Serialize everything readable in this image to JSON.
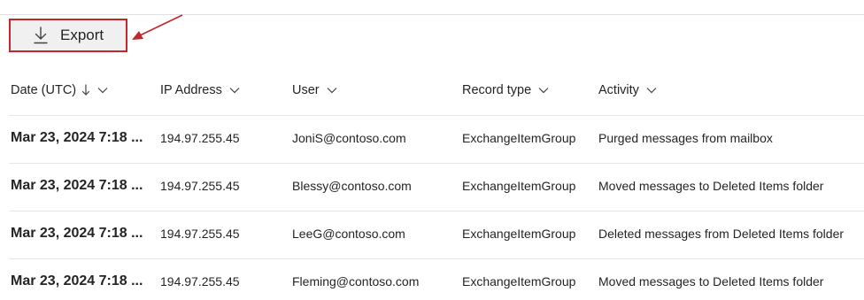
{
  "toolbar": {
    "export_label": "Export",
    "export_icon": "download-icon",
    "highlight_color": "#c4262e"
  },
  "table": {
    "columns": [
      {
        "label": "Date (UTC)",
        "sorted": "descending"
      },
      {
        "label": "IP Address"
      },
      {
        "label": "User"
      },
      {
        "label": "Record type"
      },
      {
        "label": "Activity"
      }
    ],
    "rows": [
      {
        "date": "Mar 23, 2024 7:18 ...",
        "ip": "194.97.255.45",
        "user": "JoniS@contoso.com",
        "record_type": "ExchangeItemGroup",
        "activity": "Purged messages from mailbox"
      },
      {
        "date": "Mar 23, 2024 7:18 ...",
        "ip": "194.97.255.45",
        "user": "Blessy@contoso.com",
        "record_type": "ExchangeItemGroup",
        "activity": "Moved messages to Deleted Items folder"
      },
      {
        "date": "Mar 23, 2024 7:18 ...",
        "ip": "194.97.255.45",
        "user": "LeeG@contoso.com",
        "record_type": "ExchangeItemGroup",
        "activity": "Deleted messages from Deleted Items folder"
      },
      {
        "date": "Mar 23, 2024 7:18 ...",
        "ip": "194.97.255.45",
        "user": "Fleming@contoso.com",
        "record_type": "ExchangeItemGroup",
        "activity": "Moved messages to Deleted Items folder"
      }
    ]
  }
}
